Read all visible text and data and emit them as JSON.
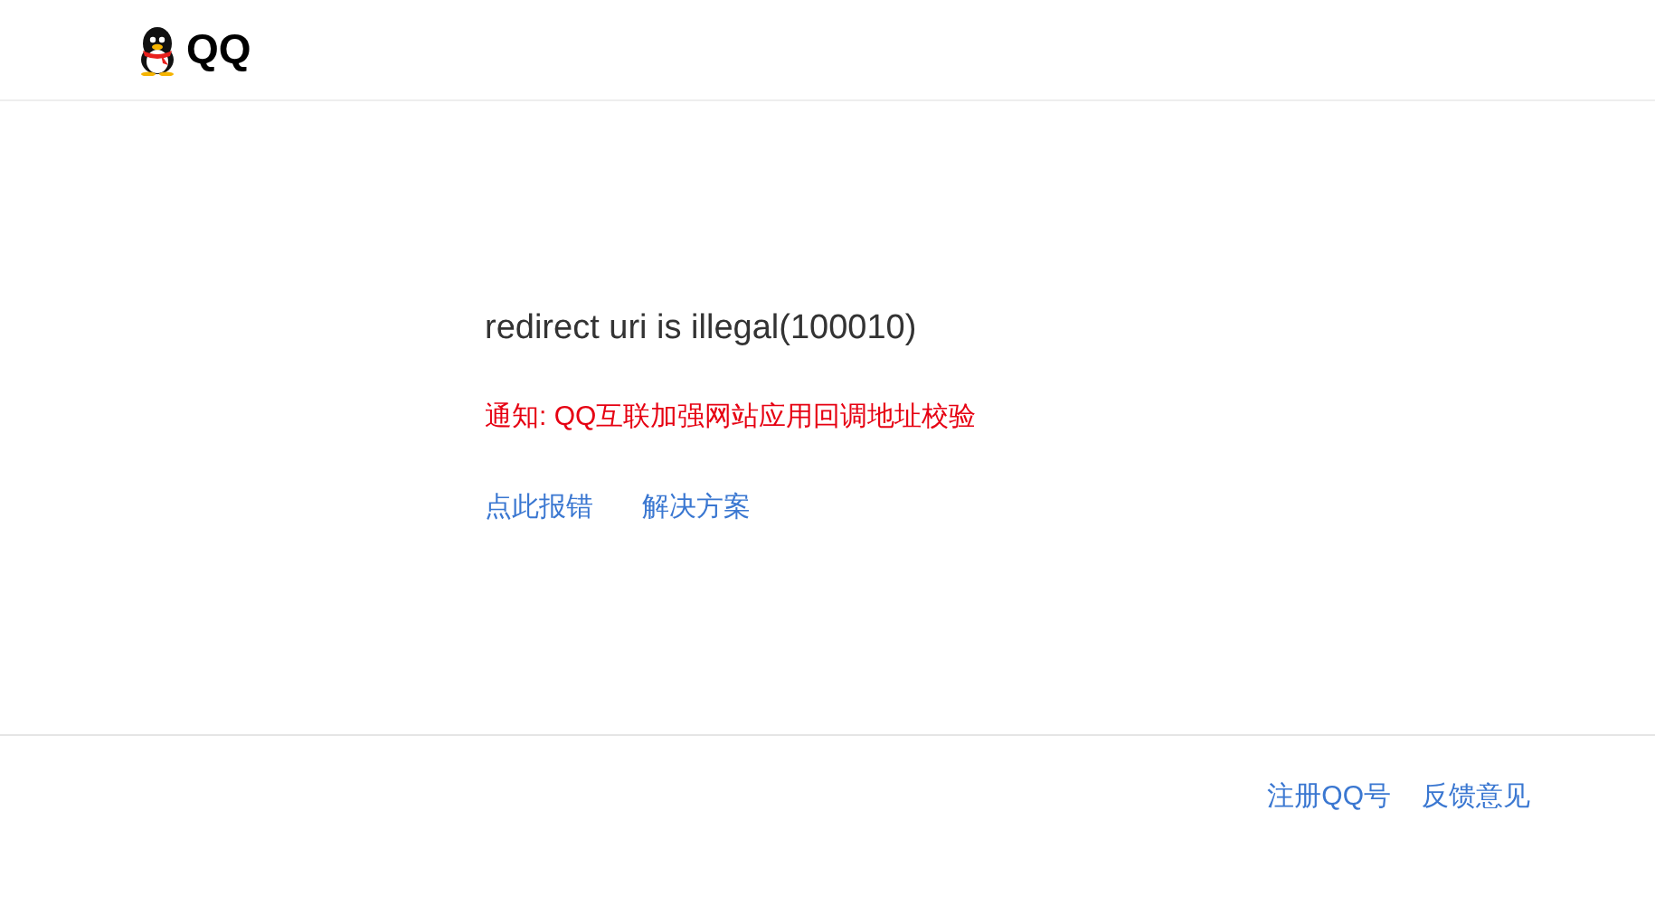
{
  "header": {
    "logo_text": "QQ"
  },
  "error": {
    "title": "redirect uri is illegal(100010)",
    "notice": "通知: QQ互联加强网站应用回调地址校验",
    "links": [
      "点此报错",
      "解决方案"
    ]
  },
  "footer": {
    "links": [
      "注册QQ号",
      "反馈意见"
    ]
  }
}
